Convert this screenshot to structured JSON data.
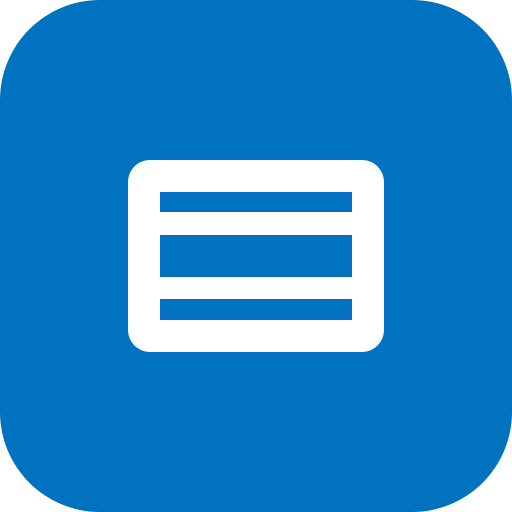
{
  "icon": {
    "name": "list-view-icon",
    "background_color": "#0072bf",
    "foreground_color": "#ffffff"
  }
}
